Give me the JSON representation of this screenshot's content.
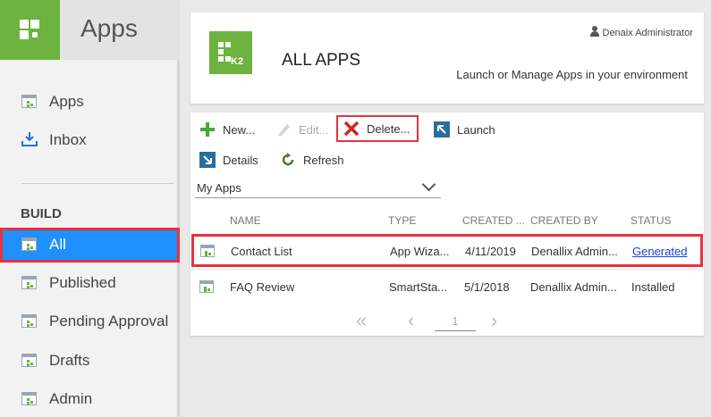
{
  "sidebar": {
    "title": "Apps",
    "items": [
      {
        "label": "Apps"
      },
      {
        "label": "Inbox"
      }
    ],
    "section_label": "BUILD",
    "build_items": [
      {
        "label": "All"
      },
      {
        "label": "Published"
      },
      {
        "label": "Pending Approval"
      },
      {
        "label": "Drafts"
      },
      {
        "label": "Admin"
      }
    ]
  },
  "header": {
    "logo_text": "K2",
    "title": "ALL APPS",
    "user": "Denaix Administrator",
    "subtitle": "Launch or Manage Apps in your environment"
  },
  "toolbar": {
    "new_label": "New...",
    "edit_label": "Edit...",
    "delete_label": "Delete...",
    "launch_label": "Launch",
    "details_label": "Details",
    "refresh_label": "Refresh"
  },
  "filter": {
    "selected": "My Apps"
  },
  "table": {
    "columns": [
      "NAME",
      "TYPE",
      "CREATED ...",
      "CREATED BY",
      "STATUS"
    ],
    "rows": [
      {
        "name": "Contact List",
        "type": "App Wiza...",
        "created": "4/11/2019",
        "created_by": "Denallix Admin...",
        "status": "Generated"
      },
      {
        "name": "FAQ Review",
        "type": "SmartSta...",
        "created": "5/1/2018",
        "created_by": "Denallix Admin...",
        "status": "Installed"
      }
    ]
  },
  "pager": {
    "page": "1"
  },
  "colors": {
    "accent": "#6db33f",
    "active": "#1e90ff",
    "highlight": "#e8323c"
  }
}
